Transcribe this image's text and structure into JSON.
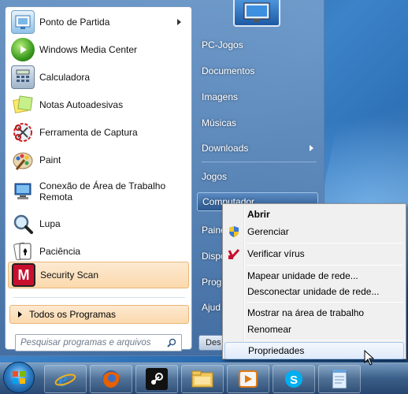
{
  "start_menu": {
    "programs": [
      {
        "label": "Ponto de Partida",
        "icon": "getting-started-icon",
        "has_submenu": true
      },
      {
        "label": "Windows Media Center",
        "icon": "media-center-icon",
        "has_submenu": false
      },
      {
        "label": "Calculadora",
        "icon": "calculator-icon",
        "has_submenu": false
      },
      {
        "label": "Notas Autoadesivas",
        "icon": "sticky-notes-icon",
        "has_submenu": false
      },
      {
        "label": "Ferramenta de Captura",
        "icon": "snipping-tool-icon",
        "has_submenu": false
      },
      {
        "label": "Paint",
        "icon": "paint-palette-icon",
        "has_submenu": false
      },
      {
        "label_line1": "Conexão de Área de Trabalho",
        "label_line2": "Remota",
        "icon": "remote-desktop-icon",
        "has_submenu": false
      },
      {
        "label": "Lupa",
        "icon": "magnifier-icon",
        "has_submenu": false
      },
      {
        "label": "Paciência",
        "icon": "solitaire-icon",
        "has_submenu": false
      },
      {
        "label": "Security Scan",
        "icon": "mcafee-security-scan-icon",
        "has_submenu": false
      }
    ],
    "all_programs": "Todos os Programas",
    "search_placeholder": "Pesquisar programas e arquivos",
    "right_items": [
      {
        "label": "PC-Jogos"
      },
      {
        "label": "Documentos"
      },
      {
        "label": "Imagens"
      },
      {
        "label": "Músicas"
      },
      {
        "label": "Downloads",
        "has_submenu": true
      },
      {
        "label": "Jogos"
      },
      {
        "label": "Computador"
      },
      {
        "label": "Paine"
      },
      {
        "label": "Dispo"
      },
      {
        "label": "Progr"
      },
      {
        "label": "Ajud"
      }
    ],
    "shutdown_label": "Des"
  },
  "context_menu": {
    "items": [
      {
        "label": "Abrir",
        "bold": true,
        "icon": ""
      },
      {
        "label": "Gerenciar",
        "bold": false,
        "icon": "uac-shield-icon"
      },
      {
        "label": "Verificar vírus",
        "bold": false,
        "icon": "mcafee-scan-icon"
      },
      {
        "label": "Mapear unidade de rede...",
        "bold": false,
        "icon": ""
      },
      {
        "label": "Desconectar unidade de rede...",
        "bold": false,
        "icon": ""
      },
      {
        "label": "Mostrar na área de trabalho",
        "bold": false,
        "icon": ""
      },
      {
        "label": "Renomear",
        "bold": false,
        "icon": ""
      },
      {
        "label": "Propriedades",
        "bold": false,
        "icon": "",
        "hovered": true
      }
    ]
  },
  "taskbar": {
    "items": [
      "start-orb-icon",
      "internet-explorer-icon",
      "firefox-icon",
      "steam-icon",
      "file-explorer-icon",
      "media-player-icon",
      "skype-icon",
      "notepad-icon"
    ]
  },
  "colors": {
    "highlight": "#fbd9ad",
    "menu_blue": "#466ea0",
    "mcafee_red": "#c8102e"
  }
}
